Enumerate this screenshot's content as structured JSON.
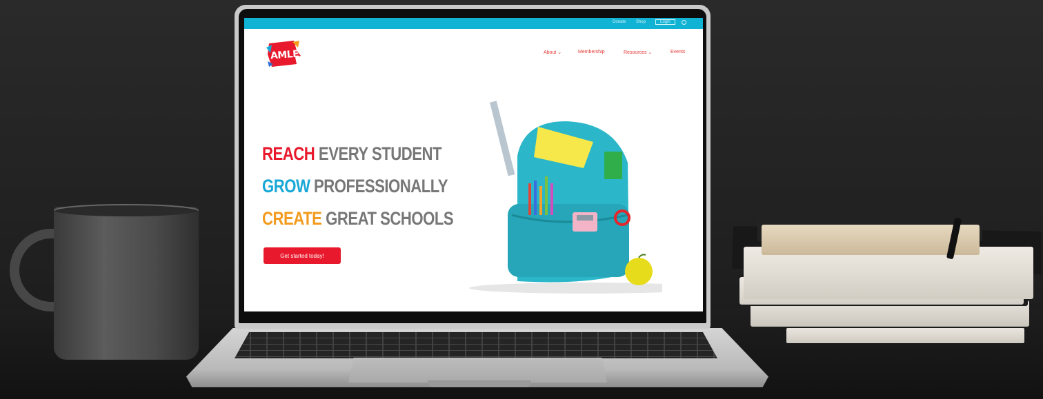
{
  "utility_bar": {
    "link1": "Donate",
    "link2": "Shop",
    "login": "Login"
  },
  "logo": {
    "text": "AMLE"
  },
  "nav": {
    "items": [
      {
        "label": "About ⌄"
      },
      {
        "label": "Membership"
      },
      {
        "label": "Resources ⌄"
      },
      {
        "label": "Events"
      }
    ]
  },
  "hero": {
    "lines": [
      {
        "accent": "REACH",
        "rest": "EVERY STUDENT"
      },
      {
        "accent": "GROW",
        "rest": "PROFESSIONALLY"
      },
      {
        "accent": "CREATE",
        "rest": "GREAT SCHOOLS"
      }
    ],
    "cta": "Get started today!"
  },
  "colors": {
    "topbar": "#11b3d4",
    "red": "#e8192c",
    "blue": "#19a8d6",
    "orange": "#f29b1e",
    "gray": "#777777",
    "backpack": "#2bb7c9"
  }
}
